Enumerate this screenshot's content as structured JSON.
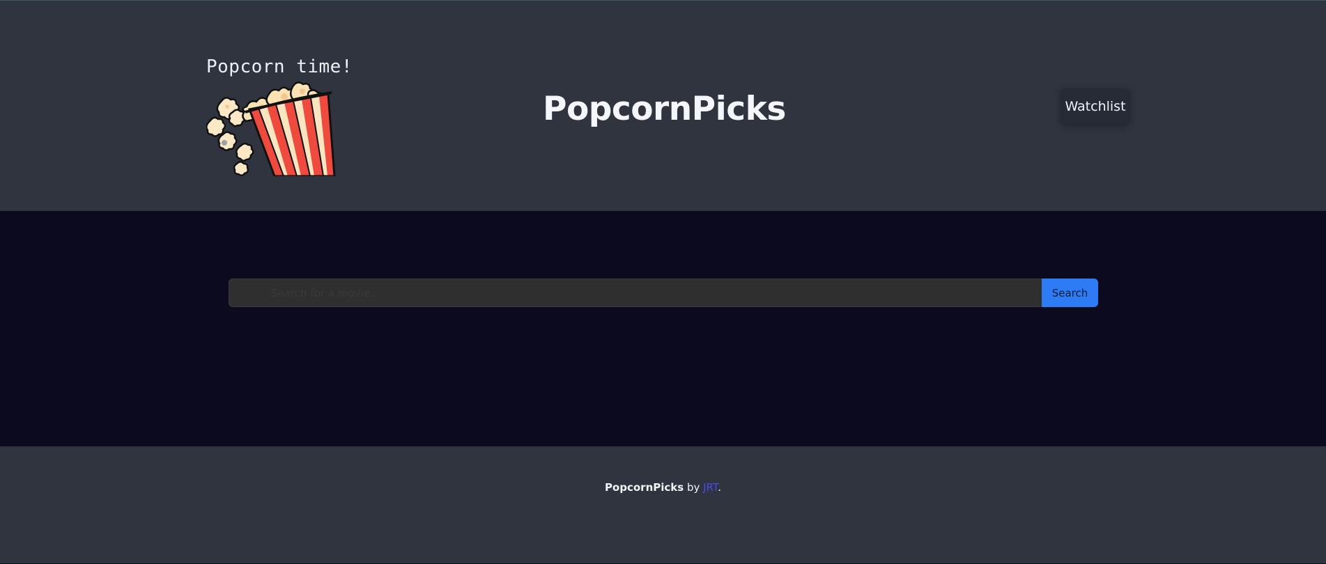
{
  "header": {
    "logo_text": "Popcorn time!",
    "logo_icon": "popcorn-bucket-icon",
    "title": "PopcornPicks",
    "watchlist_label": "Watchlist"
  },
  "search": {
    "placeholder": "Search for a movie...",
    "value": "",
    "button_label": "Search"
  },
  "footer": {
    "brand": "PopcornPicks",
    "by": " by ",
    "author": "JRT",
    "end": "."
  },
  "colors": {
    "header_bg": "#30343f",
    "main_bg": "#0b0a1e",
    "accent": "#2d7cf6",
    "link": "#4a4ae8",
    "stripe_red": "#ee4b3e",
    "stripe_cream": "#fbe5c1"
  }
}
